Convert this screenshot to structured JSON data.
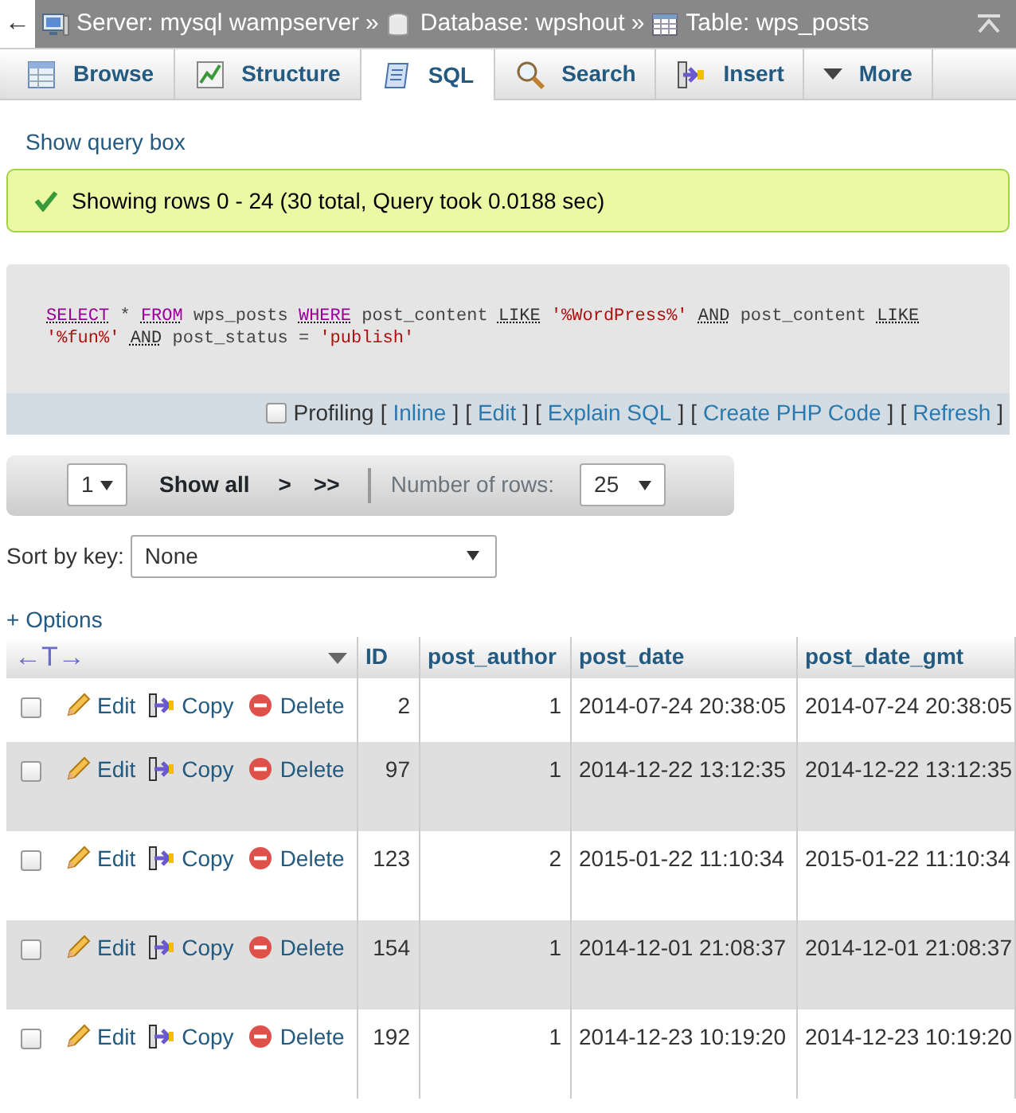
{
  "breadcrumb": {
    "back": "←",
    "items": [
      {
        "kind": "server",
        "label": "Server: mysql wampserver"
      },
      {
        "kind": "database",
        "label": "Database: wpshout"
      },
      {
        "kind": "table",
        "label": "Table: wps_posts"
      }
    ],
    "separator": "»"
  },
  "tabs": [
    {
      "kind": "browse",
      "label": "Browse",
      "selected": false
    },
    {
      "kind": "structure",
      "label": "Structure",
      "selected": false
    },
    {
      "kind": "sql",
      "label": "SQL",
      "selected": true
    },
    {
      "kind": "search",
      "label": "Search",
      "selected": false
    },
    {
      "kind": "insert",
      "label": "Insert",
      "selected": false
    },
    {
      "kind": "more",
      "label": "More",
      "selected": false
    }
  ],
  "show_query_box": "Show query box",
  "message": "Showing rows 0 - 24 (30 total, Query took 0.0188 sec)",
  "sql": {
    "tokens": [
      {
        "text": "SELECT",
        "kind": "keyword"
      },
      {
        "text": "*",
        "kind": "plain"
      },
      {
        "text": "FROM",
        "kind": "keyword"
      },
      {
        "text": "wps_posts",
        "kind": "plain"
      },
      {
        "text": "WHERE",
        "kind": "keyword"
      },
      {
        "text": "post_content",
        "kind": "plain"
      },
      {
        "text": "LIKE",
        "kind": "operator"
      },
      {
        "text": "'%WordPress%'",
        "kind": "string"
      },
      {
        "text": "AND",
        "kind": "operator"
      },
      {
        "text": "post_content",
        "kind": "plain"
      },
      {
        "text": "LIKE",
        "kind": "operator"
      },
      {
        "text": "'%fun%'",
        "kind": "string"
      },
      {
        "text": "AND",
        "kind": "operator"
      },
      {
        "text": "post_status",
        "kind": "plain"
      },
      {
        "text": "=",
        "kind": "plain"
      },
      {
        "text": "'publish'",
        "kind": "string"
      }
    ],
    "profiling": {
      "label": "Profiling",
      "checked": false
    },
    "links": [
      {
        "open": "[",
        "label": "Inline",
        "close": "]"
      },
      {
        "open": "[",
        "label": "Edit",
        "close": "]"
      },
      {
        "open": "[",
        "label": "Explain SQL",
        "close": "]"
      },
      {
        "open": "[",
        "label": "Create PHP Code",
        "close": "]"
      },
      {
        "open": "[",
        "label": "Refresh",
        "close": "]"
      }
    ]
  },
  "navigation": {
    "page": "1",
    "show_all": "Show all",
    "next": ">",
    "last": ">>",
    "rows_label": "Number of rows:",
    "rows_value": "25"
  },
  "sort": {
    "label": "Sort by key:",
    "value": "None"
  },
  "options": "+ Options",
  "table": {
    "arrows": "←T→",
    "columns": [
      "ID",
      "post_author",
      "post_date",
      "post_date_gmt"
    ],
    "rows": [
      {
        "checked": false,
        "actions": [
          "Edit",
          "Copy",
          "Delete"
        ],
        "cells": [
          "2",
          "1",
          "2014-07-24 20:38:05",
          "2014-07-24 20:38:05"
        ]
      },
      {
        "checked": false,
        "actions": [
          "Edit",
          "Copy",
          "Delete"
        ],
        "cells": [
          "97",
          "1",
          "2014-12-22 13:12:35",
          "2014-12-22 13:12:35"
        ]
      },
      {
        "checked": false,
        "actions": [
          "Edit",
          "Copy",
          "Delete"
        ],
        "cells": [
          "123",
          "2",
          "2015-01-22 11:10:34",
          "2015-01-22 11:10:34"
        ]
      },
      {
        "checked": false,
        "actions": [
          "Edit",
          "Copy",
          "Delete"
        ],
        "cells": [
          "154",
          "1",
          "2014-12-01 21:08:37",
          "2014-12-01 21:08:37"
        ]
      },
      {
        "checked": false,
        "actions": [
          "Edit",
          "Copy",
          "Delete"
        ],
        "cells": [
          "192",
          "1",
          "2014-12-23 10:19:20",
          "2014-12-23 10:19:20"
        ]
      }
    ]
  }
}
